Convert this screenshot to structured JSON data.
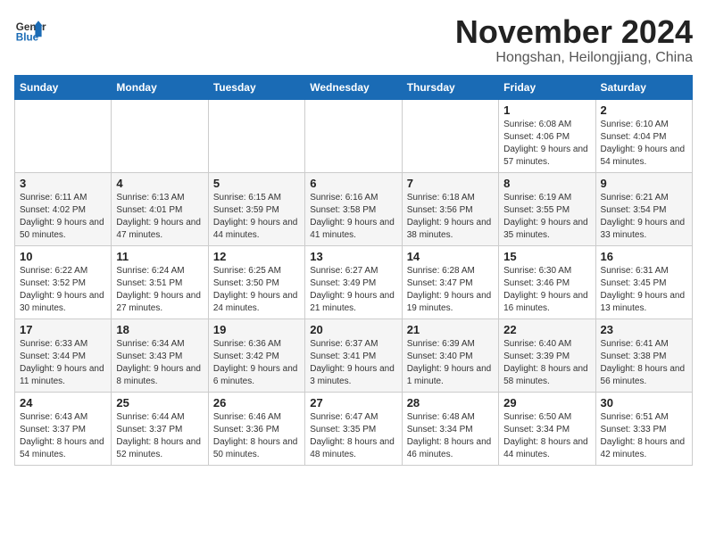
{
  "logo": {
    "line1": "General",
    "line2": "Blue"
  },
  "header": {
    "month": "November 2024",
    "location": "Hongshan, Heilongjiang, China"
  },
  "weekdays": [
    "Sunday",
    "Monday",
    "Tuesday",
    "Wednesday",
    "Thursday",
    "Friday",
    "Saturday"
  ],
  "weeks": [
    [
      {
        "day": "",
        "info": ""
      },
      {
        "day": "",
        "info": ""
      },
      {
        "day": "",
        "info": ""
      },
      {
        "day": "",
        "info": ""
      },
      {
        "day": "",
        "info": ""
      },
      {
        "day": "1",
        "info": "Sunrise: 6:08 AM\nSunset: 4:06 PM\nDaylight: 9 hours and 57 minutes."
      },
      {
        "day": "2",
        "info": "Sunrise: 6:10 AM\nSunset: 4:04 PM\nDaylight: 9 hours and 54 minutes."
      }
    ],
    [
      {
        "day": "3",
        "info": "Sunrise: 6:11 AM\nSunset: 4:02 PM\nDaylight: 9 hours and 50 minutes."
      },
      {
        "day": "4",
        "info": "Sunrise: 6:13 AM\nSunset: 4:01 PM\nDaylight: 9 hours and 47 minutes."
      },
      {
        "day": "5",
        "info": "Sunrise: 6:15 AM\nSunset: 3:59 PM\nDaylight: 9 hours and 44 minutes."
      },
      {
        "day": "6",
        "info": "Sunrise: 6:16 AM\nSunset: 3:58 PM\nDaylight: 9 hours and 41 minutes."
      },
      {
        "day": "7",
        "info": "Sunrise: 6:18 AM\nSunset: 3:56 PM\nDaylight: 9 hours and 38 minutes."
      },
      {
        "day": "8",
        "info": "Sunrise: 6:19 AM\nSunset: 3:55 PM\nDaylight: 9 hours and 35 minutes."
      },
      {
        "day": "9",
        "info": "Sunrise: 6:21 AM\nSunset: 3:54 PM\nDaylight: 9 hours and 33 minutes."
      }
    ],
    [
      {
        "day": "10",
        "info": "Sunrise: 6:22 AM\nSunset: 3:52 PM\nDaylight: 9 hours and 30 minutes."
      },
      {
        "day": "11",
        "info": "Sunrise: 6:24 AM\nSunset: 3:51 PM\nDaylight: 9 hours and 27 minutes."
      },
      {
        "day": "12",
        "info": "Sunrise: 6:25 AM\nSunset: 3:50 PM\nDaylight: 9 hours and 24 minutes."
      },
      {
        "day": "13",
        "info": "Sunrise: 6:27 AM\nSunset: 3:49 PM\nDaylight: 9 hours and 21 minutes."
      },
      {
        "day": "14",
        "info": "Sunrise: 6:28 AM\nSunset: 3:47 PM\nDaylight: 9 hours and 19 minutes."
      },
      {
        "day": "15",
        "info": "Sunrise: 6:30 AM\nSunset: 3:46 PM\nDaylight: 9 hours and 16 minutes."
      },
      {
        "day": "16",
        "info": "Sunrise: 6:31 AM\nSunset: 3:45 PM\nDaylight: 9 hours and 13 minutes."
      }
    ],
    [
      {
        "day": "17",
        "info": "Sunrise: 6:33 AM\nSunset: 3:44 PM\nDaylight: 9 hours and 11 minutes."
      },
      {
        "day": "18",
        "info": "Sunrise: 6:34 AM\nSunset: 3:43 PM\nDaylight: 9 hours and 8 minutes."
      },
      {
        "day": "19",
        "info": "Sunrise: 6:36 AM\nSunset: 3:42 PM\nDaylight: 9 hours and 6 minutes."
      },
      {
        "day": "20",
        "info": "Sunrise: 6:37 AM\nSunset: 3:41 PM\nDaylight: 9 hours and 3 minutes."
      },
      {
        "day": "21",
        "info": "Sunrise: 6:39 AM\nSunset: 3:40 PM\nDaylight: 9 hours and 1 minute."
      },
      {
        "day": "22",
        "info": "Sunrise: 6:40 AM\nSunset: 3:39 PM\nDaylight: 8 hours and 58 minutes."
      },
      {
        "day": "23",
        "info": "Sunrise: 6:41 AM\nSunset: 3:38 PM\nDaylight: 8 hours and 56 minutes."
      }
    ],
    [
      {
        "day": "24",
        "info": "Sunrise: 6:43 AM\nSunset: 3:37 PM\nDaylight: 8 hours and 54 minutes."
      },
      {
        "day": "25",
        "info": "Sunrise: 6:44 AM\nSunset: 3:37 PM\nDaylight: 8 hours and 52 minutes."
      },
      {
        "day": "26",
        "info": "Sunrise: 6:46 AM\nSunset: 3:36 PM\nDaylight: 8 hours and 50 minutes."
      },
      {
        "day": "27",
        "info": "Sunrise: 6:47 AM\nSunset: 3:35 PM\nDaylight: 8 hours and 48 minutes."
      },
      {
        "day": "28",
        "info": "Sunrise: 6:48 AM\nSunset: 3:34 PM\nDaylight: 8 hours and 46 minutes."
      },
      {
        "day": "29",
        "info": "Sunrise: 6:50 AM\nSunset: 3:34 PM\nDaylight: 8 hours and 44 minutes."
      },
      {
        "day": "30",
        "info": "Sunrise: 6:51 AM\nSunset: 3:33 PM\nDaylight: 8 hours and 42 minutes."
      }
    ]
  ]
}
